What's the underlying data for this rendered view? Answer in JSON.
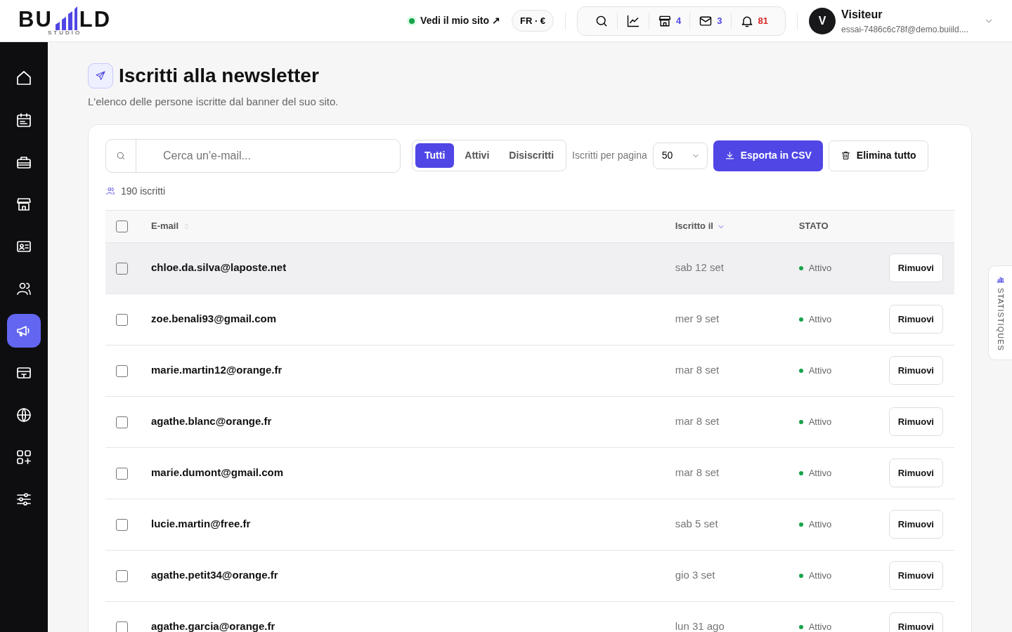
{
  "header": {
    "logo": {
      "left": "BU",
      "right": "LD",
      "sub": "STUDIO"
    },
    "site_link": {
      "label": "Vedi il mio sito ↗",
      "online": true
    },
    "locale": {
      "language": "FR",
      "separator": "·",
      "currency": "€"
    },
    "toolbar": [
      {
        "kind": "search"
      },
      {
        "kind": "chart"
      },
      {
        "kind": "store",
        "count": "4",
        "color": "#4f46e5"
      },
      {
        "kind": "mail",
        "count": "3",
        "color": "#4f46e5"
      },
      {
        "kind": "bell",
        "count": "81",
        "color": "#dc2626"
      }
    ],
    "user": {
      "initial": "V",
      "name": "Visiteur",
      "email": "essai-7486c6c78f@demo.buiild...."
    }
  },
  "sidebar": {
    "items": [
      {
        "kind": "home",
        "selected": false
      },
      {
        "kind": "calendar",
        "selected": false
      },
      {
        "kind": "toolbox",
        "selected": false
      },
      {
        "kind": "store",
        "selected": false
      },
      {
        "kind": "contact",
        "selected": false
      },
      {
        "kind": "users",
        "selected": false
      },
      {
        "kind": "megaphone",
        "selected": true
      },
      {
        "kind": "card",
        "selected": false
      },
      {
        "kind": "globe",
        "selected": false
      },
      {
        "kind": "apps",
        "selected": false
      },
      {
        "kind": "sliders",
        "selected": false
      }
    ]
  },
  "page": {
    "title": "Iscritti alla newsletter",
    "subtitle": "L'elenco delle persone iscritte dal banner del suo sito."
  },
  "toolbar": {
    "search": {
      "placeholder": "Cerca un'e-mail..."
    },
    "filters": [
      {
        "label": "Tutti",
        "selected": true
      },
      {
        "label": "Attivi",
        "selected": false
      },
      {
        "label": "Disiscritti",
        "selected": false
      }
    ],
    "per_page_label": "Iscritti per pagina",
    "per_page": "50",
    "export_button": "Esporta in CSV",
    "delete_button": "Elimina tutto"
  },
  "count": "190 iscritti",
  "table": {
    "columns": [
      "E-mail",
      "Iscritto il",
      "STATO"
    ],
    "all_checked": false,
    "rows": [
      {
        "email": "chloe.da.silva@laposte.net",
        "date": "sab 12 set",
        "status": "Attivo",
        "color": "#16a34a",
        "action": "Rimuovi",
        "checked": false,
        "highlighted": true
      },
      {
        "email": "zoe.benali93@gmail.com",
        "date": "mer 9 set",
        "status": "Attivo",
        "color": "#16a34a",
        "action": "Rimuovi",
        "checked": false,
        "highlighted": false
      },
      {
        "email": "marie.martin12@orange.fr",
        "date": "mar 8 set",
        "status": "Attivo",
        "color": "#16a34a",
        "action": "Rimuovi",
        "checked": false,
        "highlighted": false
      },
      {
        "email": "agathe.blanc@orange.fr",
        "date": "mar 8 set",
        "status": "Attivo",
        "color": "#16a34a",
        "action": "Rimuovi",
        "checked": false,
        "highlighted": false
      },
      {
        "email": "marie.dumont@gmail.com",
        "date": "mar 8 set",
        "status": "Attivo",
        "color": "#16a34a",
        "action": "Rimuovi",
        "checked": false,
        "highlighted": false
      },
      {
        "email": "lucie.martin@free.fr",
        "date": "sab 5 set",
        "status": "Attivo",
        "color": "#16a34a",
        "action": "Rimuovi",
        "checked": false,
        "highlighted": false
      },
      {
        "email": "agathe.petit34@orange.fr",
        "date": "gio 3 set",
        "status": "Attivo",
        "color": "#16a34a",
        "action": "Rimuovi",
        "checked": false,
        "highlighted": false
      },
      {
        "email": "agathe.garcia@orange.fr",
        "date": "lun 31 ago",
        "status": "Attivo",
        "color": "#16a34a",
        "action": "Rimuovi",
        "checked": false,
        "highlighted": false
      }
    ]
  },
  "side_tab": "STATISTIQUES"
}
